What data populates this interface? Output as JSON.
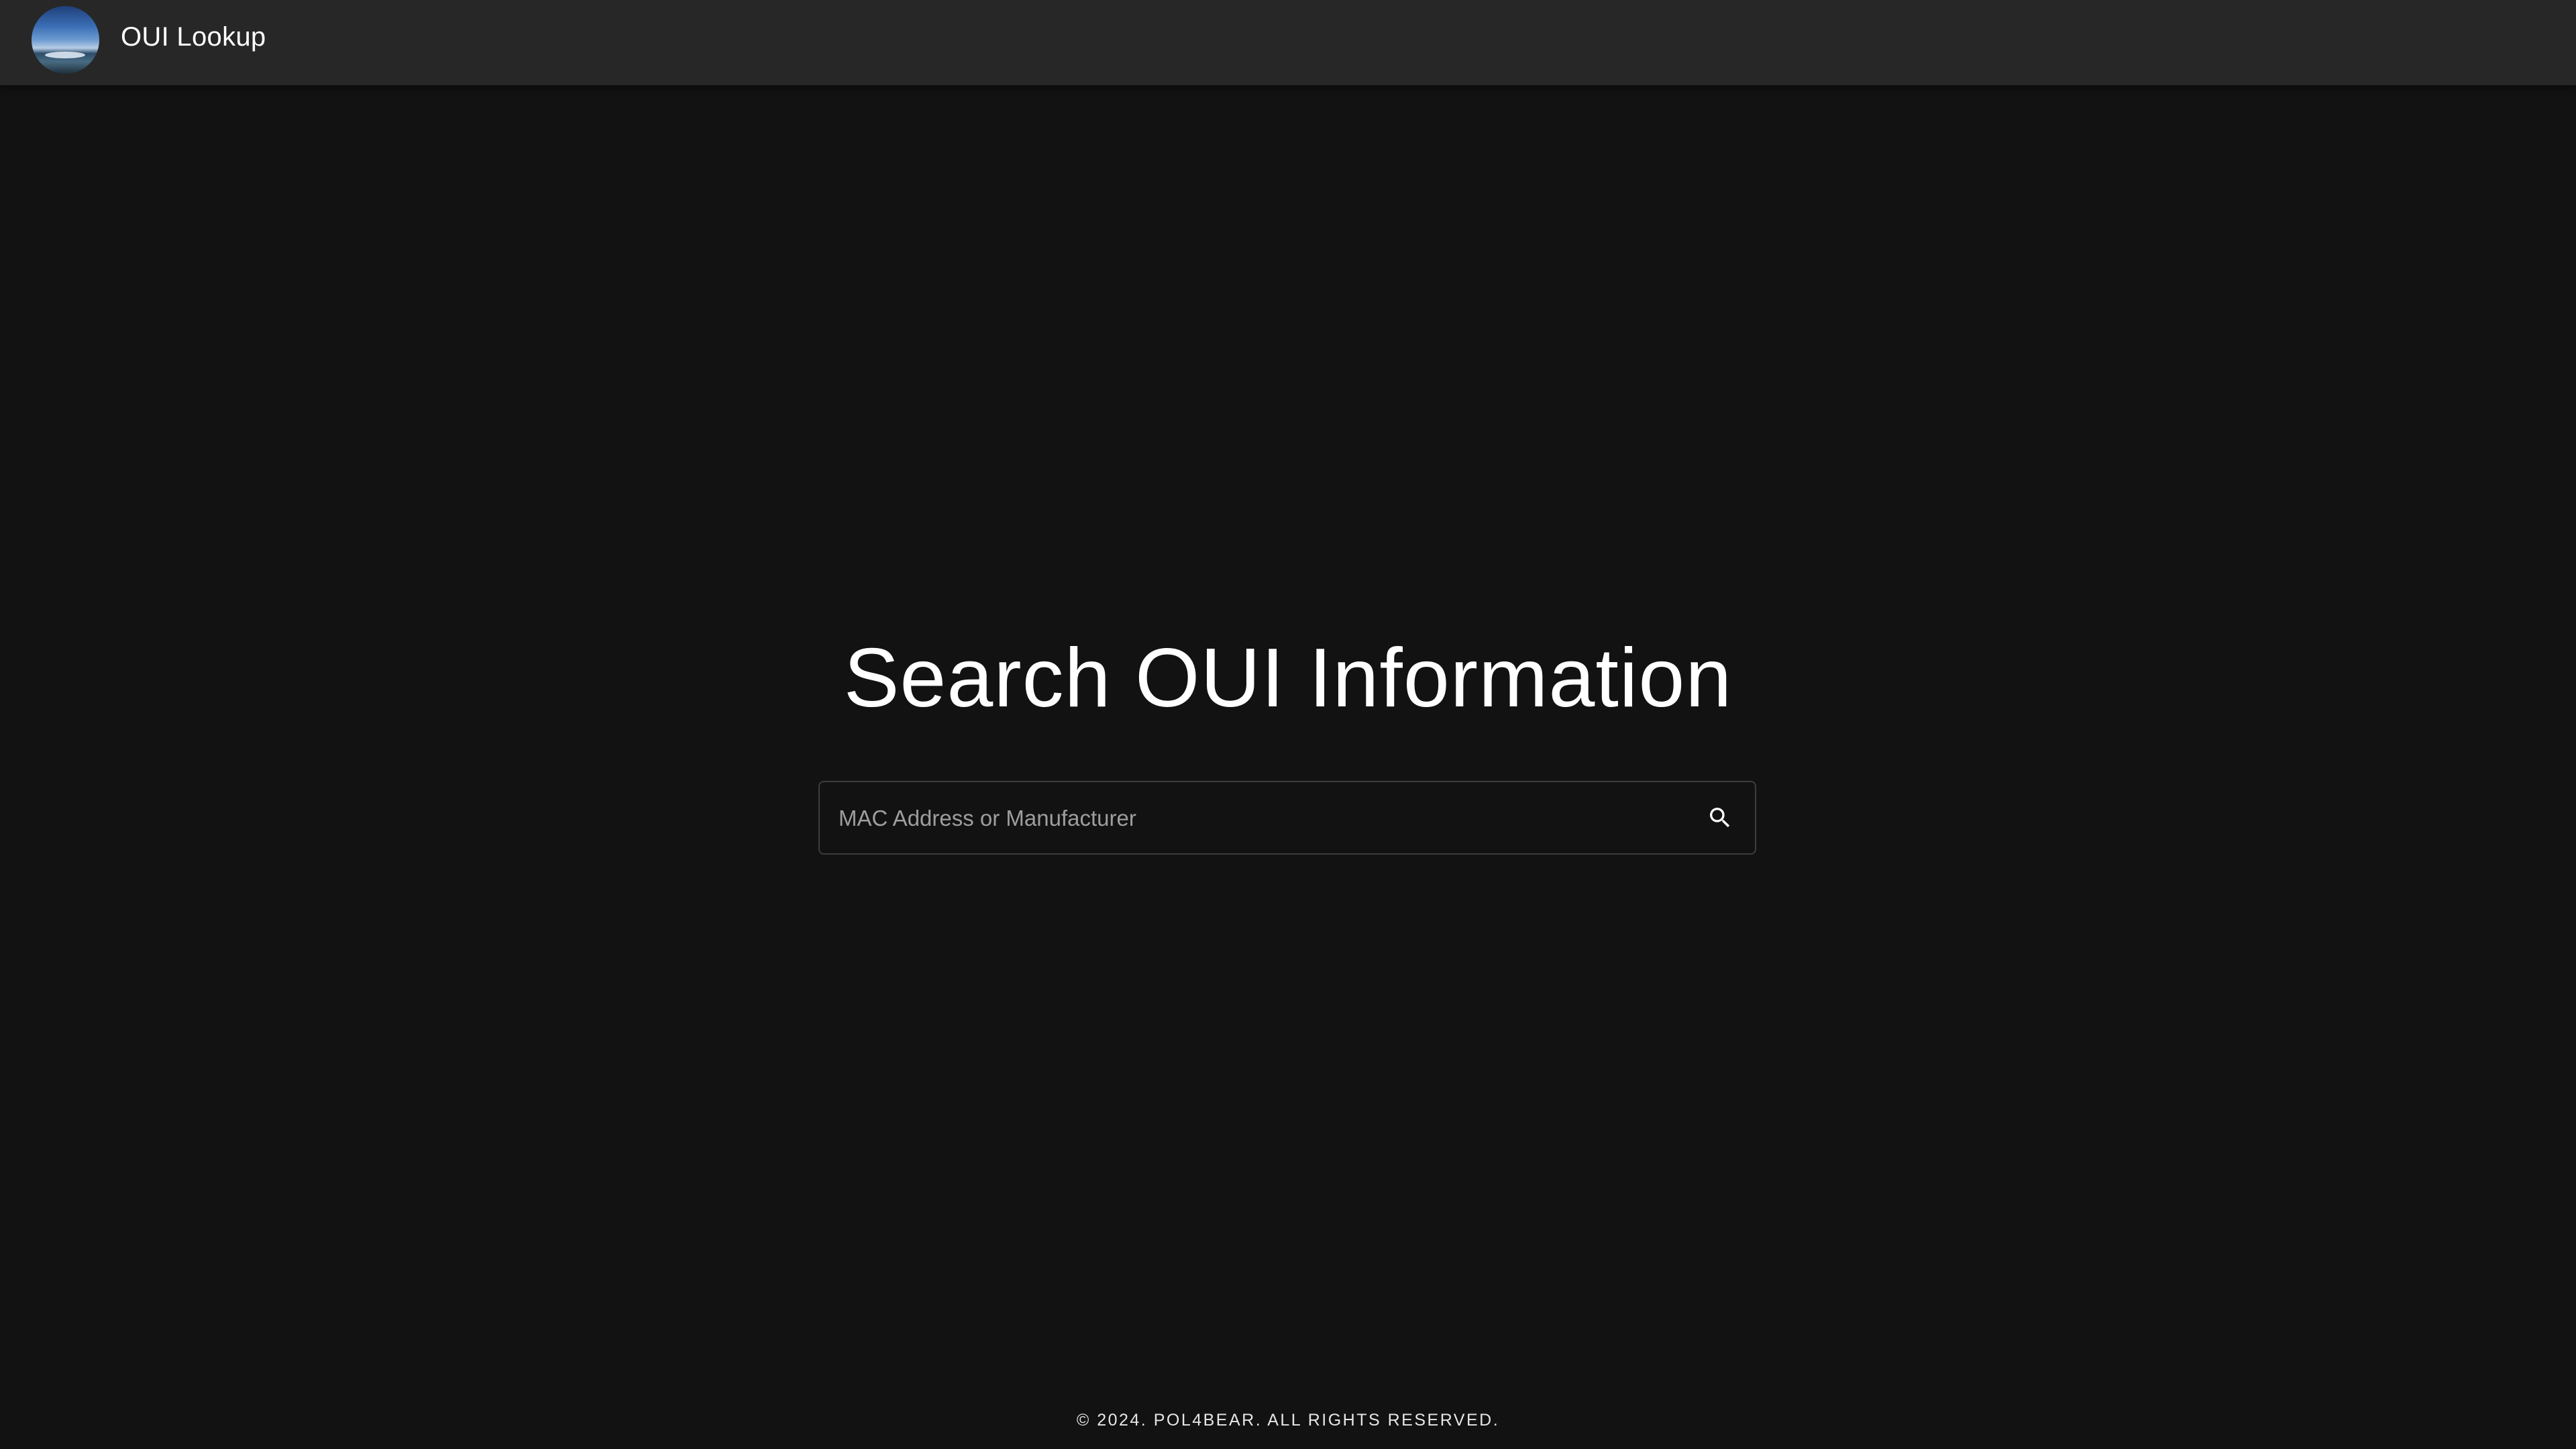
{
  "app": {
    "title": "OUI Lookup",
    "avatar_icon": "ocean-landscape-avatar"
  },
  "main": {
    "headline": "Search OUI Information",
    "search": {
      "placeholder": "MAC Address or Manufacturer",
      "value": "",
      "button_icon": "search-icon"
    }
  },
  "footer": {
    "text": "© 2024. POL4BEAR. ALL RIGHTS RESERVED."
  },
  "colors": {
    "background": "#121212",
    "appbar": "#272727",
    "text": "#ffffff",
    "placeholder": "#9e9e9e",
    "border": "#3d3d3d"
  }
}
